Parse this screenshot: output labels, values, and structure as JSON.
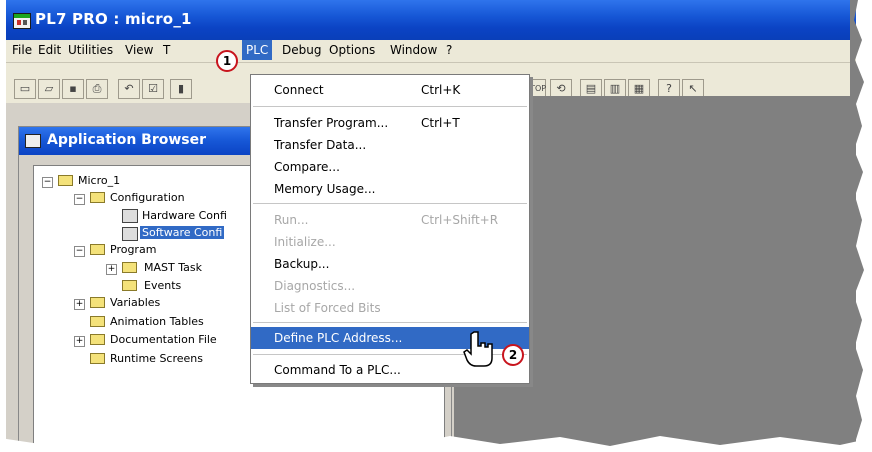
{
  "window": {
    "title": "PL7 PRO : micro_1"
  },
  "menubar": {
    "items": [
      "File",
      "Edit",
      "Utilities",
      "View",
      "T",
      "PLC",
      "Debug",
      "Options",
      "Window",
      "?"
    ]
  },
  "callouts": {
    "one": "1",
    "two": "2"
  },
  "toolbar": {
    "stop_label": "STOP"
  },
  "browser": {
    "title": "Application Browser",
    "tree": {
      "root": "Micro_1",
      "configuration": "Configuration",
      "hardware": "Hardware Confi",
      "software": "Software Confi",
      "program": "Program",
      "mast": "MAST Task",
      "events": "Events",
      "variables": "Variables",
      "animation": "Animation Tables",
      "documentation": "Documentation File",
      "runtime": "Runtime Screens"
    }
  },
  "plc_menu": {
    "connect": {
      "label": "Connect",
      "shortcut": "Ctrl+K"
    },
    "transfer_program": {
      "label": "Transfer Program...",
      "shortcut": "Ctrl+T"
    },
    "transfer_data": {
      "label": "Transfer Data..."
    },
    "compare": {
      "label": "Compare..."
    },
    "memory_usage": {
      "label": "Memory Usage..."
    },
    "run": {
      "label": "Run...",
      "shortcut": "Ctrl+Shift+R"
    },
    "initialize": {
      "label": "Initialize..."
    },
    "backup": {
      "label": "Backup..."
    },
    "diagnostics": {
      "label": "Diagnostics..."
    },
    "forced_bits": {
      "label": "List of Forced Bits"
    },
    "define_address": {
      "label": "Define PLC Address..."
    },
    "command": {
      "label": "Command To a PLC..."
    }
  },
  "colors": {
    "title_blue": "#0b43c4",
    "highlight": "#316ac5",
    "callout_red": "#c8141d"
  }
}
